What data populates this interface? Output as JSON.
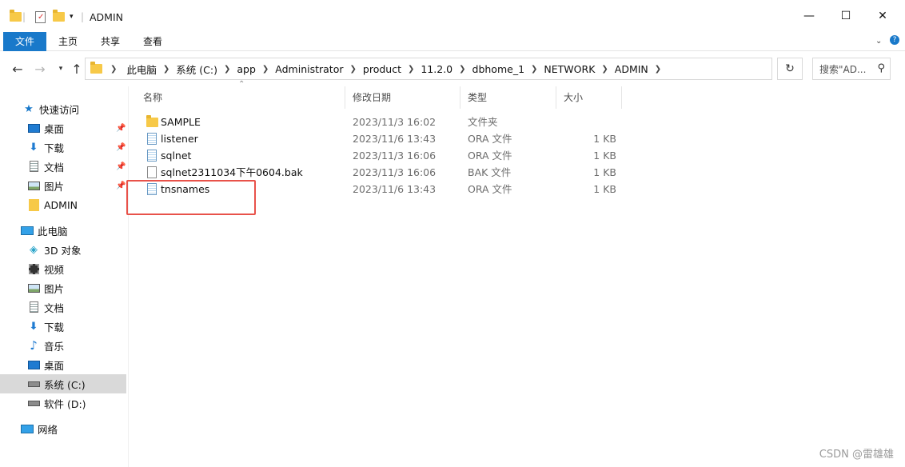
{
  "window": {
    "title": "ADMIN",
    "minimize_glyph": "—",
    "maximize_glyph": "☐",
    "close_glyph": "✕"
  },
  "ribbon": {
    "tabs": [
      {
        "label": "文件",
        "active": true
      },
      {
        "label": "主页",
        "active": false
      },
      {
        "label": "共享",
        "active": false
      },
      {
        "label": "查看",
        "active": false
      }
    ]
  },
  "address": {
    "crumbs": [
      "此电脑",
      "系统 (C:)",
      "app",
      "Administrator",
      "product",
      "11.2.0",
      "dbhome_1",
      "NETWORK",
      "ADMIN"
    ],
    "search_placeholder": "搜索\"AD..."
  },
  "navpane": {
    "items": [
      {
        "label": "快速访问",
        "icon": "star-icon",
        "pinned": false
      },
      {
        "label": "桌面",
        "icon": "desktop-icon",
        "pinned": true
      },
      {
        "label": "下载",
        "icon": "download-icon",
        "pinned": true
      },
      {
        "label": "文档",
        "icon": "document-icon",
        "pinned": true
      },
      {
        "label": "图片",
        "icon": "picture-icon",
        "pinned": true
      },
      {
        "label": "ADMIN",
        "icon": "folder-icon",
        "pinned": false
      },
      {
        "label": "此电脑",
        "icon": "computer-icon",
        "pinned": false
      },
      {
        "label": "3D 对象",
        "icon": "cube-icon",
        "pinned": false
      },
      {
        "label": "视频",
        "icon": "video-icon",
        "pinned": false
      },
      {
        "label": "图片",
        "icon": "picture-icon",
        "pinned": false
      },
      {
        "label": "文档",
        "icon": "document-icon",
        "pinned": false
      },
      {
        "label": "下载",
        "icon": "download-icon",
        "pinned": false
      },
      {
        "label": "音乐",
        "icon": "music-icon",
        "pinned": false
      },
      {
        "label": "桌面",
        "icon": "desktop-icon",
        "pinned": false
      },
      {
        "label": "系统 (C:)",
        "icon": "drive-icon",
        "pinned": false,
        "selected": true
      },
      {
        "label": "软件 (D:)",
        "icon": "drive-icon",
        "pinned": false
      },
      {
        "label": "网络",
        "icon": "network-icon",
        "pinned": false
      }
    ]
  },
  "columns": {
    "name": "名称",
    "date": "修改日期",
    "type": "类型",
    "size": "大小"
  },
  "files": [
    {
      "name": "SAMPLE",
      "date": "2023/11/3 16:02",
      "type": "文件夹",
      "size": "",
      "kind": "folder"
    },
    {
      "name": "listener",
      "date": "2023/11/6 13:43",
      "type": "ORA 文件",
      "size": "1 KB",
      "kind": "ora"
    },
    {
      "name": "sqlnet",
      "date": "2023/11/3 16:06",
      "type": "ORA 文件",
      "size": "1 KB",
      "kind": "ora"
    },
    {
      "name": "sqlnet2311034下午0604.bak",
      "date": "2023/11/3 16:06",
      "type": "BAK 文件",
      "size": "1 KB",
      "kind": "file"
    },
    {
      "name": "tnsnames",
      "date": "2023/11/6 13:43",
      "type": "ORA 文件",
      "size": "1 KB",
      "kind": "ora"
    }
  ],
  "watermark": "CSDN @雷雄雄",
  "colors": {
    "accent": "#1979ca",
    "highlight": "#e8524a",
    "folder": "#f7c948"
  }
}
